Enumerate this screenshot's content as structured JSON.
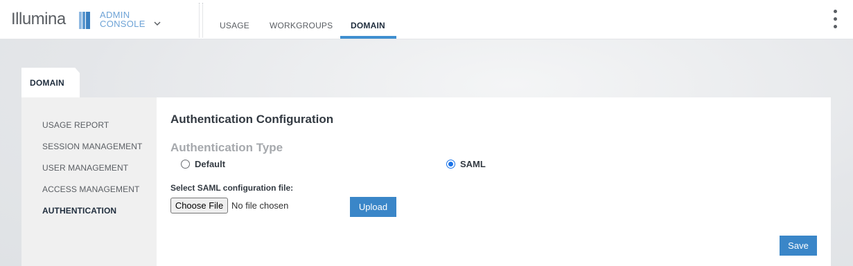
{
  "header": {
    "logo": "Illumina",
    "console_line1": "ADMIN",
    "console_line2": "CONSOLE",
    "tabs": [
      {
        "label": "USAGE"
      },
      {
        "label": "WORKGROUPS"
      },
      {
        "label": "DOMAIN"
      }
    ],
    "active_tab": "DOMAIN"
  },
  "section_tab": {
    "label": "DOMAIN"
  },
  "sidebar": {
    "items": [
      {
        "label": "USAGE REPORT"
      },
      {
        "label": "SESSION MANAGEMENT"
      },
      {
        "label": "USER MANAGEMENT"
      },
      {
        "label": "ACCESS MANAGEMENT"
      },
      {
        "label": "AUTHENTICATION"
      }
    ],
    "active_item": "AUTHENTICATION"
  },
  "main": {
    "title": "Authentication Configuration",
    "auth_type_heading": "Authentication Type",
    "options": [
      {
        "label": "Default",
        "checked": false
      },
      {
        "label": "SAML",
        "checked": true
      }
    ],
    "file_label": "Select SAML configuration file:",
    "choose_file_label": "Choose File",
    "no_file_text": "No file chosen",
    "upload_label": "Upload",
    "save_label": "Save"
  },
  "colors": {
    "accent": "#3a86c8",
    "nav_underline": "#3f8fd0",
    "console_text": "#6ea3d6",
    "radio_selected": "#1a73e8"
  },
  "icons": {
    "logo_mark": "illumina-bars-icon",
    "console_dropdown": "chevron-down-icon",
    "menu": "kebab-menu-icon"
  }
}
